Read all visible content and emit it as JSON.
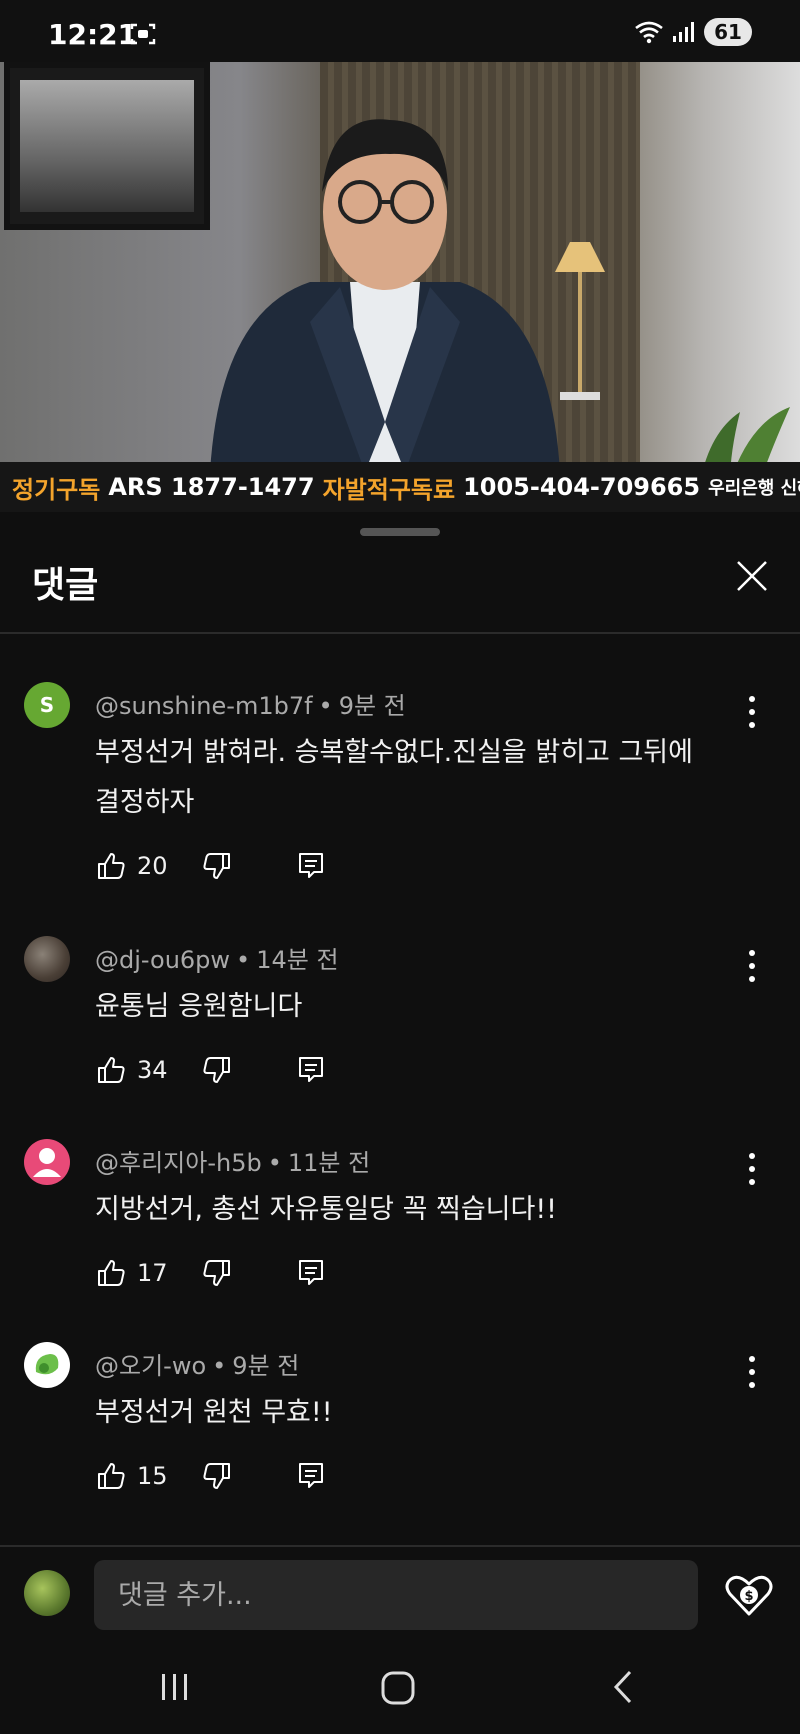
{
  "status": {
    "time": "12:21",
    "battery": "61"
  },
  "video": {
    "ticker": {
      "part1": "정기구독",
      "part2": "ARS 1877-1477",
      "part3": "자발적구독료",
      "part4": "1005-404-709665",
      "part5": "우리은행 신혜식"
    }
  },
  "sheet": {
    "title": "댓글"
  },
  "comments": [
    {
      "handle": "@sunshine-m1b7f",
      "avatar_letter": "S",
      "time": "9분 전",
      "text": "부정선거 밝혀라. 승복할수없다.진실을 밝히고 그뒤에 결정하자",
      "likes": "20"
    },
    {
      "handle": "@dj-ou6pw",
      "time": "14분 전",
      "text": "윤통님 응원함니다",
      "likes": "34"
    },
    {
      "handle": "@후리지아-h5b",
      "time": "11분 전",
      "text": "지방선거, 총선 자유통일당 꼭 찍습니다!!",
      "likes": "17"
    },
    {
      "handle": "@오기-wo",
      "time": "9분 전",
      "text": "부정선거 원천 무효!!",
      "likes": "15"
    }
  ],
  "input": {
    "placeholder": "댓글 추가..."
  },
  "colors": {
    "background": "#0f0f0f",
    "secondary_text": "#aaaaaa",
    "ticker_orange": "#f4a42c"
  }
}
